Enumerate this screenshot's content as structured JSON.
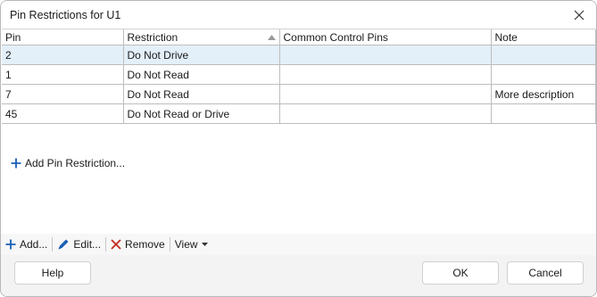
{
  "window": {
    "title": "Pin Restrictions for U1"
  },
  "table": {
    "columns": [
      "Pin",
      "Restriction",
      "Common Control Pins",
      "Note"
    ],
    "rows": [
      {
        "pin": "2",
        "restriction": "Do Not Drive",
        "common": "",
        "note": ""
      },
      {
        "pin": "1",
        "restriction": "Do Not Read",
        "common": "",
        "note": ""
      },
      {
        "pin": "7",
        "restriction": "Do Not Read",
        "common": "",
        "note": "More description"
      },
      {
        "pin": "45",
        "restriction": "Do Not Read or Drive",
        "common": "",
        "note": ""
      }
    ],
    "add_link": "Add Pin Restriction..."
  },
  "toolbar": {
    "add": "Add...",
    "edit": "Edit...",
    "remove": "Remove",
    "view": "View"
  },
  "footer": {
    "help": "Help",
    "ok": "OK",
    "cancel": "Cancel"
  },
  "colors": {
    "accent": "#1a5fb4",
    "remove": "#c42b1c",
    "selected_row": "#e3eff9"
  }
}
